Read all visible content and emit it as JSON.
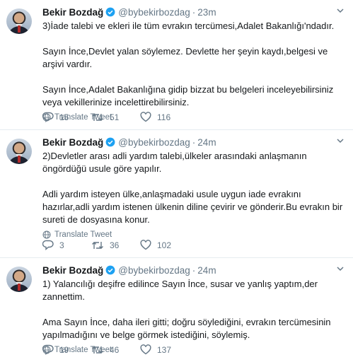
{
  "tweets": [
    {
      "name": "Bekir Bozdağ",
      "handle": "@bybekirbozdag",
      "dot": "·",
      "time": "23m",
      "paragraphs": [
        "3)İade talebi ve ekleri ile tüm evrakın tercümesi,Adalet Bakanlığı'ndadır.",
        "Sayın İnce,Devlet yalan söylemez. Devlette her şeyin kaydı,belgesi ve arşivi vardır.",
        "Sayın İnce,Adalet Bakanlığına gidip bizzat bu belgeleri inceleyebilirsiniz veya vekillerinize incelettirebilirsiniz."
      ],
      "translate": "Translate Tweet",
      "replies": "15",
      "retweets": "51",
      "likes": "116"
    },
    {
      "name": "Bekir Bozdağ",
      "handle": "@bybekirbozdag",
      "dot": "·",
      "time": "24m",
      "paragraphs": [
        "2)Devletler arası adli yardım talebi,ülkeler arasındaki anlaşmanın öngördüğü usule göre yapılır.",
        "Adli yardım isteyen ülke,anlaşmadaki usule uygun iade evrakını hazırlar,adli yardım istenen ülkenin diline çevirir ve gönderir.Bu evrakın bir sureti de dosyasına konur."
      ],
      "translate": "Translate Tweet",
      "replies": "3",
      "retweets": "36",
      "likes": "102"
    },
    {
      "name": "Bekir Bozdağ",
      "handle": "@bybekirbozdag",
      "dot": "·",
      "time": "24m",
      "paragraphs": [
        "1) Yalancılığı deşifre edilince Sayın İnce, susar ve yanlış yaptım,der zannettim.",
        "Ama Sayın İnce, daha ileri gitti; doğru söylediğini, evrakın tercümesinin yapılmadığını ve belge görmek istediğini, söylemiş."
      ],
      "translate": "Translate Tweet",
      "replies": "19",
      "retweets": "46",
      "likes": "137"
    }
  ],
  "icons": {
    "verified": "verified-badge-icon",
    "chevron": "chevron-down-icon",
    "translate": "globe-icon",
    "reply": "reply-icon",
    "retweet": "retweet-icon",
    "like": "heart-icon"
  },
  "colors": {
    "verified": "#1da1f2",
    "secondary_text": "#657786",
    "divider": "#e6ecf0"
  }
}
